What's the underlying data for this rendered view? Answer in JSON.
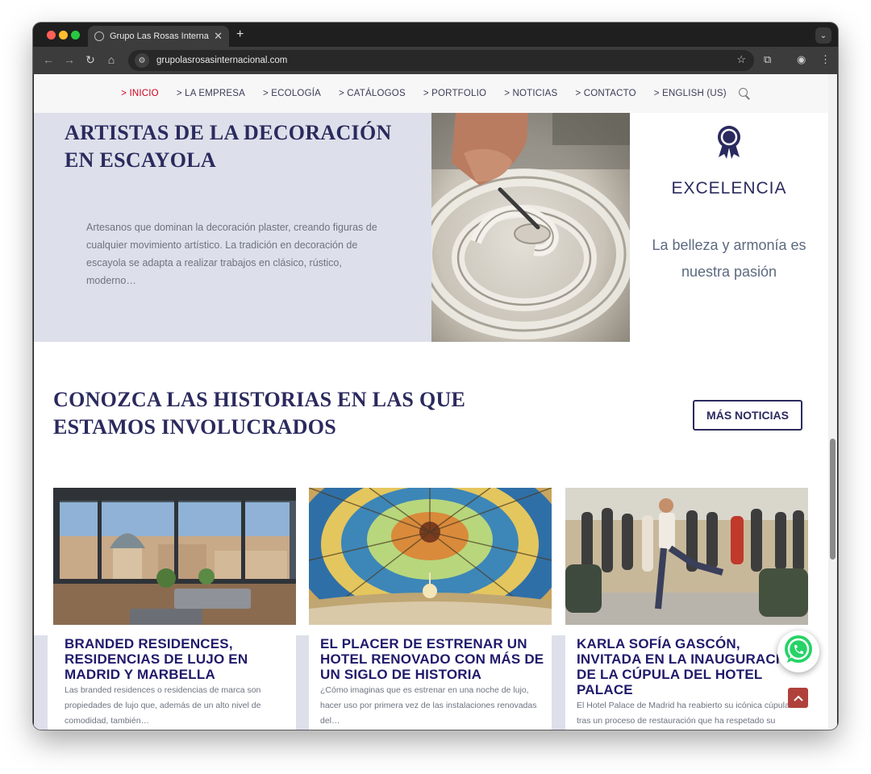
{
  "browser": {
    "tab_title": "Grupo Las Rosas Internacional",
    "url": "grupolasrosasinternacional.com"
  },
  "nav": {
    "items": [
      "> INICIO",
      "> LA EMPRESA",
      "> ECOLOGÍA",
      "> CATÁLOGOS",
      "> PORTFOLIO",
      "> NOTICIAS",
      "> CONTACTO",
      "> ENGLISH (US)"
    ],
    "active_index": 0
  },
  "hero": {
    "title": "ARTISTAS DE LA DECORACIÓN EN ESCAYOLA",
    "text": "Artesanos que dominan la decoración plaster, creando figuras de cualquier movimiento artístico. La tradición en decoración de escayola se adapta a realizar trabajos en clásico, rústico, moderno…"
  },
  "excellence": {
    "icon": "award-ribbon-icon",
    "title": "EXCELENCIA",
    "text": "La belleza y armonía es nuestra pasión"
  },
  "news": {
    "title": "CONOZCA LAS HISTORIAS EN LAS QUE ESTAMOS INVOLUCRADOS",
    "more_label": "MÁS NOTICIAS",
    "cards": [
      {
        "title": "BRANDED RESIDENCES, RESIDENCIAS DE LUJO EN MADRID Y MARBELLA",
        "text": "Las branded residences o residencias de marca son propiedades de lujo que, además de un alto nivel de comodidad, también…"
      },
      {
        "title": "EL PLACER DE ESTRENAR UN HOTEL RENOVADO CON MÁS DE UN SIGLO DE HISTORIA",
        "text": "¿Cómo imaginas que es estrenar en una noche de lujo, hacer uso por primera vez de las instalaciones renovadas del…"
      },
      {
        "title": "KARLA SOFÍA GASCÓN, INVITADA EN LA INAUGURACIÓN DE LA CÚPULA DEL HOTEL PALACE",
        "text": "El Hotel Palace de Madrid ha reabierto su icónica cúpula tras un proceso de restauración que ha respetado su"
      }
    ]
  },
  "colors": {
    "brand_navy": "#2a2a5e",
    "active_red": "#d0021b",
    "panel_lavender": "#dde0ea"
  }
}
